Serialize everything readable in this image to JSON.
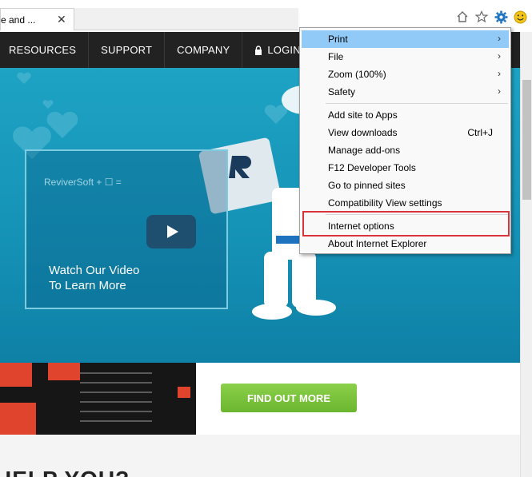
{
  "browser": {
    "tab_title": "e and ...",
    "tab_close": "✕",
    "icons": [
      "home-icon",
      "favorites-star-icon",
      "tools-gear-icon",
      "smiley-feedback-icon"
    ],
    "accent_color": "#1e73be"
  },
  "nav": {
    "items": [
      {
        "label": "RESOURCES"
      },
      {
        "label": "SUPPORT"
      },
      {
        "label": "COMPANY"
      },
      {
        "label": "LOGIN"
      }
    ]
  },
  "hero": {
    "video_logo": "ReviverSoft + ☐ =",
    "video_text_line1": "Watch Our Video",
    "video_text_line2": "To Learn More"
  },
  "lower": {
    "find_button": "FIND OUT MORE",
    "help_text": "HELP YOU?"
  },
  "menu": {
    "items": [
      {
        "label": "Print",
        "submenu": true,
        "highlighted": true
      },
      {
        "label": "File",
        "submenu": true
      },
      {
        "label": "Zoom (100%)",
        "submenu": true
      },
      {
        "label": "Safety",
        "submenu": true
      },
      {
        "label": "Add site to Apps"
      },
      {
        "label": "View downloads",
        "shortcut": "Ctrl+J"
      },
      {
        "label": "Manage add-ons"
      },
      {
        "label": "F12 Developer Tools"
      },
      {
        "label": "Go to pinned sites"
      },
      {
        "label": "Compatibility View settings"
      },
      {
        "label": "Internet options",
        "callout": true
      },
      {
        "label": "About Internet Explorer"
      }
    ],
    "arrow_glyph": "›"
  }
}
